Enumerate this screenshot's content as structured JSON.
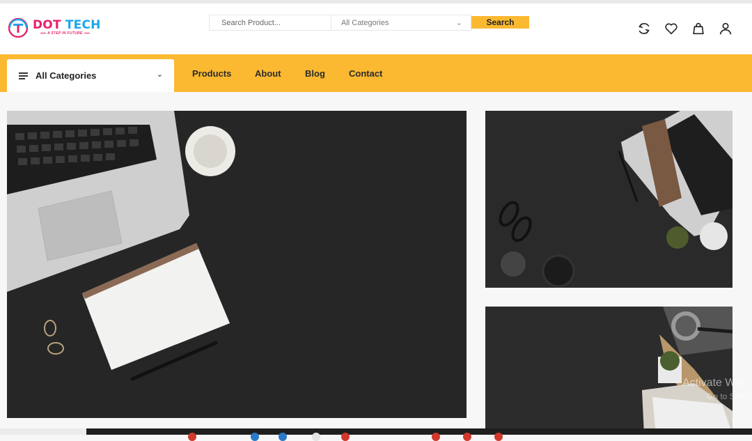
{
  "brand": {
    "name_part1": "DOT",
    "name_part2": "TECH",
    "tagline": "A STEP IN FUTURE",
    "colors": {
      "pink": "#e9216b",
      "blue": "#1ba6ec"
    }
  },
  "search": {
    "placeholder": "Search Product...",
    "category_selected": "All Categories",
    "button_label": "Search"
  },
  "header_icons": [
    "refresh-icon",
    "heart-icon",
    "shopping-bag-icon",
    "user-icon"
  ],
  "nav": {
    "all_categories_label": "All Categories",
    "items": [
      {
        "label": "Products"
      },
      {
        "label": "About"
      },
      {
        "label": "Blog"
      },
      {
        "label": "Contact"
      }
    ]
  },
  "banners": [
    {
      "name": "hero-laptop-notebook"
    },
    {
      "name": "laptop-glasses-desk"
    },
    {
      "name": "keyboard-magnifier-desk"
    }
  ],
  "watermark": {
    "line1": "Activate Win",
    "line2": "Go to Settings to"
  },
  "colors": {
    "accent": "#fbb931",
    "dark_bg": "#252525",
    "page_bg": "#f7f7f7"
  }
}
